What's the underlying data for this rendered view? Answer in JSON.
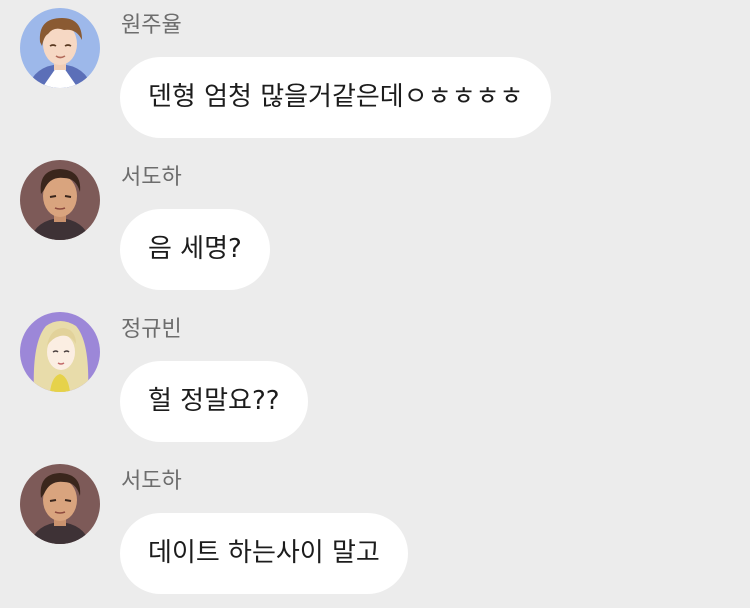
{
  "messages": [
    {
      "sender": "원주율",
      "text": "덴형 엄청 많을거같은데ㅇㅎㅎㅎㅎ",
      "avatar": "male-light-brown-hair-avatar",
      "avatar_bg": "#9db8ea"
    },
    {
      "sender": "서도하",
      "text": "음 세명?",
      "avatar": "male-dark-hair-avatar",
      "avatar_bg": "#7d5a58"
    },
    {
      "sender": "정규빈",
      "text": "헐 정말요??",
      "avatar": "female-curly-blonde-hair-avatar",
      "avatar_bg": "#9c87d8"
    },
    {
      "sender": "서도하",
      "text": "데이트 하는사이 말고",
      "avatar": "male-dark-hair-avatar",
      "avatar_bg": "#7d5a58"
    }
  ],
  "theme": {
    "background": "#ececec",
    "bubble": "#ffffff",
    "name_color": "#6d6d6d",
    "text_color": "#1c1c1c"
  }
}
